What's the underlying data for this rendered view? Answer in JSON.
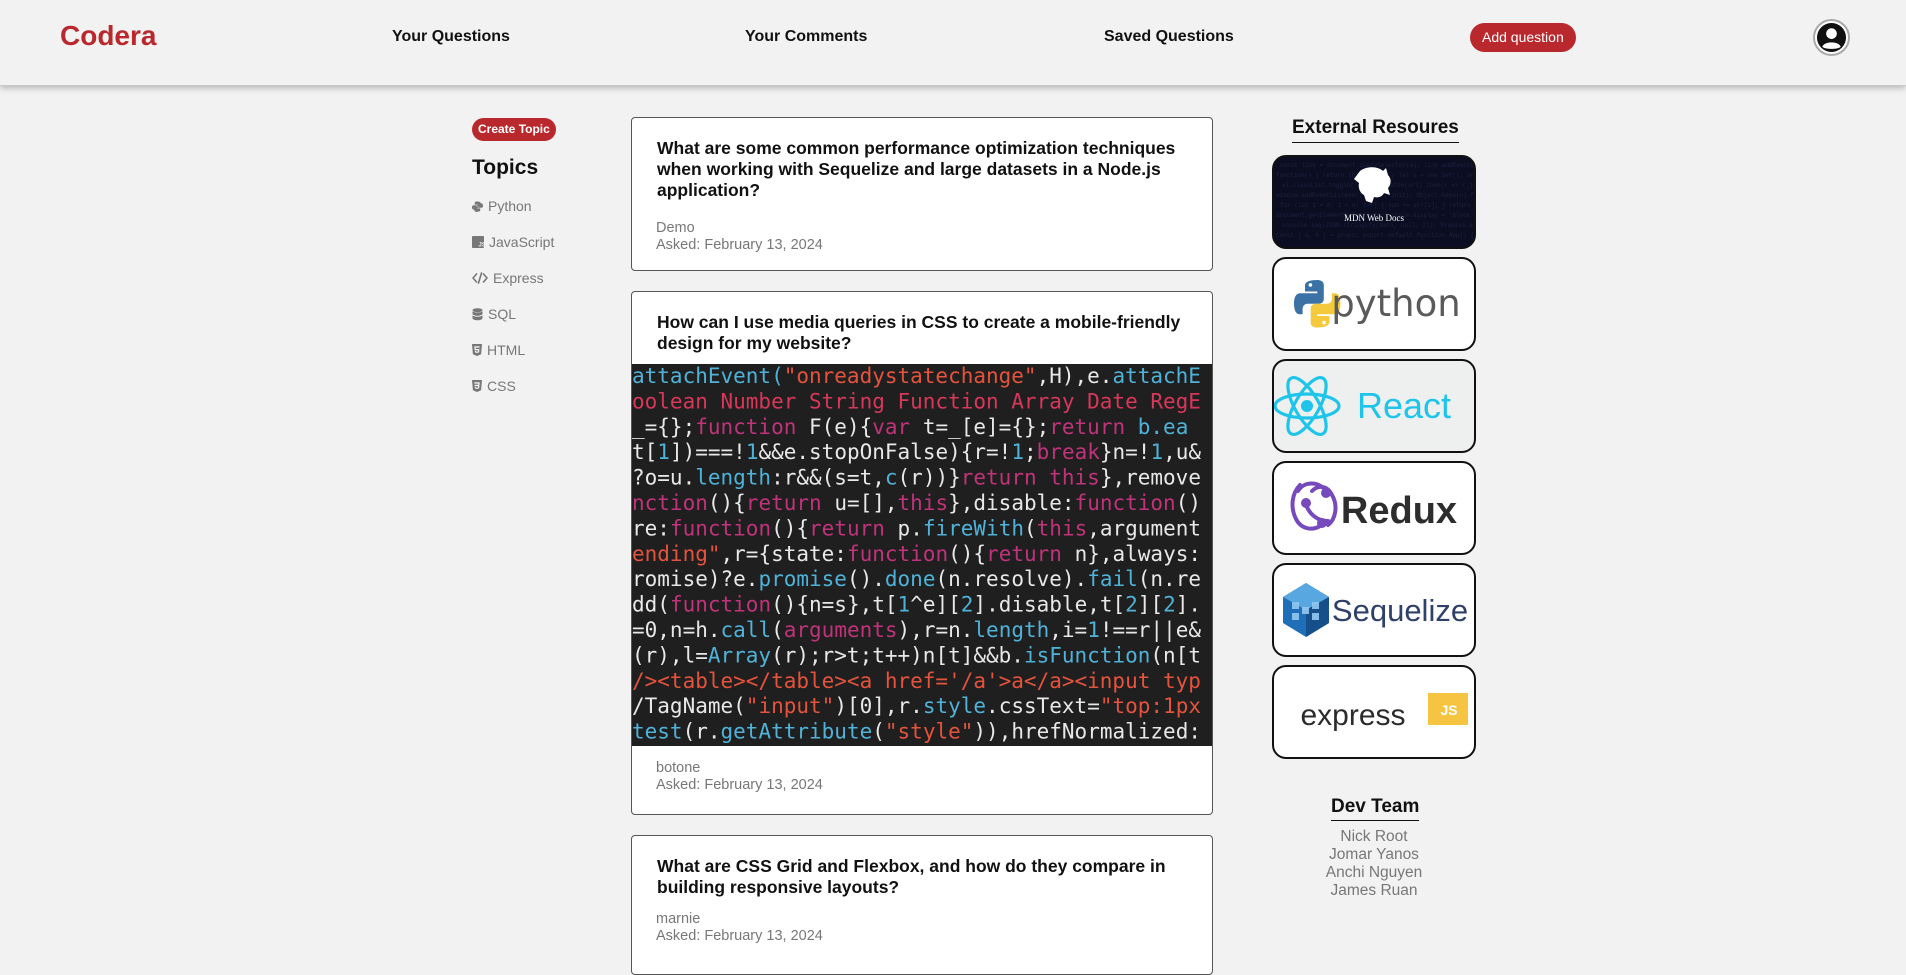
{
  "header": {
    "logo": "Codera",
    "nav": [
      "Your Questions",
      "Your Comments",
      "Saved Questions"
    ],
    "add_question": "Add question",
    "brand_color": "#b9282c"
  },
  "sidebar": {
    "create_topic": "Create Topic",
    "title": "Topics",
    "topics": [
      {
        "label": "Python",
        "icon": "python-icon"
      },
      {
        "label": "JavaScript",
        "icon": "javascript-icon"
      },
      {
        "label": "Express",
        "icon": "code-icon"
      },
      {
        "label": "SQL",
        "icon": "database-icon"
      },
      {
        "label": "HTML",
        "icon": "html5-icon"
      },
      {
        "label": "CSS",
        "icon": "css3-icon"
      }
    ]
  },
  "questions": [
    {
      "title": "What are some common performance optimization techniques when working with Sequelize and large datasets in a Node.js application?",
      "author": "Demo",
      "asked": "Asked: February 13, 2024"
    },
    {
      "title": "How can I use media queries in CSS to create a mobile-friendly design for my website?",
      "has_image": true,
      "author": "botone",
      "asked": "Asked: February 13, 2024"
    },
    {
      "title": "What are CSS Grid and Flexbox, and how do they compare in building responsive layouts?",
      "author": "marnie",
      "asked": "Asked: February 13, 2024"
    }
  ],
  "code_image_lines": [
    {
      "segments": [
        {
          "t": "attachEvent(",
          "c": "#4fb3d9"
        },
        {
          "t": "\"onreadystatechange\"",
          "c": "#e5533d"
        },
        {
          "t": ",H),e.",
          "c": "#e8e8e8"
        },
        {
          "t": "attachE",
          "c": "#4fb3d9"
        }
      ]
    },
    {
      "segments": [
        {
          "t": "oolean Number String Function Array Date RegE",
          "c": "#d8375a"
        }
      ]
    },
    {
      "segments": [
        {
          "t": " _={};",
          "c": "#e8e8e8"
        },
        {
          "t": "function ",
          "c": "#c0337a"
        },
        {
          "t": "F(e){",
          "c": "#e8e8e8"
        },
        {
          "t": "var ",
          "c": "#c0337a"
        },
        {
          "t": "t=_[e]={};",
          "c": "#e8e8e8"
        },
        {
          "t": "return ",
          "c": "#c0337a"
        },
        {
          "t": "b.ea",
          "c": "#4fb3d9"
        }
      ]
    },
    {
      "segments": [
        {
          "t": "t[",
          "c": "#e8e8e8"
        },
        {
          "t": "1",
          "c": "#4fb3d9"
        },
        {
          "t": "])===!",
          "c": "#e8e8e8"
        },
        {
          "t": "1",
          "c": "#4fb3d9"
        },
        {
          "t": "&&e.stopOnFalse){r=!",
          "c": "#e8e8e8"
        },
        {
          "t": "1",
          "c": "#4fb3d9"
        },
        {
          "t": ";",
          "c": "#e8e8e8"
        },
        {
          "t": "break",
          "c": "#c0337a"
        },
        {
          "t": "}n=!",
          "c": "#e8e8e8"
        },
        {
          "t": "1",
          "c": "#4fb3d9"
        },
        {
          "t": ",u&",
          "c": "#e8e8e8"
        }
      ]
    },
    {
      "segments": [
        {
          "t": "?o=u.",
          "c": "#e8e8e8"
        },
        {
          "t": "length",
          "c": "#4fb3d9"
        },
        {
          "t": ":r&&(s=t,",
          "c": "#e8e8e8"
        },
        {
          "t": "c",
          "c": "#4fb3d9"
        },
        {
          "t": "(r))}",
          "c": "#e8e8e8"
        },
        {
          "t": "return this",
          "c": "#c0337a"
        },
        {
          "t": "},remove",
          "c": "#e8e8e8"
        }
      ]
    },
    {
      "segments": [
        {
          "t": "nction",
          "c": "#c0337a"
        },
        {
          "t": "(){",
          "c": "#e8e8e8"
        },
        {
          "t": "return ",
          "c": "#c0337a"
        },
        {
          "t": "u=[],",
          "c": "#e8e8e8"
        },
        {
          "t": "this",
          "c": "#c0337a"
        },
        {
          "t": "},disable:",
          "c": "#e8e8e8"
        },
        {
          "t": "function",
          "c": "#c0337a"
        },
        {
          "t": "()",
          "c": "#e8e8e8"
        }
      ]
    },
    {
      "segments": [
        {
          "t": "re:",
          "c": "#e8e8e8"
        },
        {
          "t": "function",
          "c": "#c0337a"
        },
        {
          "t": "(){",
          "c": "#e8e8e8"
        },
        {
          "t": "return ",
          "c": "#c0337a"
        },
        {
          "t": "p.",
          "c": "#e8e8e8"
        },
        {
          "t": "fireWith",
          "c": "#4fb3d9"
        },
        {
          "t": "(",
          "c": "#e8e8e8"
        },
        {
          "t": "this",
          "c": "#c0337a"
        },
        {
          "t": ",argument",
          "c": "#e8e8e8"
        }
      ]
    },
    {
      "segments": [
        {
          "t": "ending\"",
          "c": "#e5533d"
        },
        {
          "t": ",r={state:",
          "c": "#e8e8e8"
        },
        {
          "t": "function",
          "c": "#c0337a"
        },
        {
          "t": "(){",
          "c": "#e8e8e8"
        },
        {
          "t": "return ",
          "c": "#c0337a"
        },
        {
          "t": "n},always:",
          "c": "#e8e8e8"
        }
      ]
    },
    {
      "segments": [
        {
          "t": "romise)?e.",
          "c": "#e8e8e8"
        },
        {
          "t": "promise",
          "c": "#4fb3d9"
        },
        {
          "t": "().",
          "c": "#e8e8e8"
        },
        {
          "t": "done",
          "c": "#4fb3d9"
        },
        {
          "t": "(n.resolve).",
          "c": "#e8e8e8"
        },
        {
          "t": "fail",
          "c": "#4fb3d9"
        },
        {
          "t": "(n.re",
          "c": "#e8e8e8"
        }
      ]
    },
    {
      "segments": [
        {
          "t": "dd(",
          "c": "#e8e8e8"
        },
        {
          "t": "function",
          "c": "#c0337a"
        },
        {
          "t": "(){n=s},t[",
          "c": "#e8e8e8"
        },
        {
          "t": "1",
          "c": "#4fb3d9"
        },
        {
          "t": "^e][",
          "c": "#e8e8e8"
        },
        {
          "t": "2",
          "c": "#4fb3d9"
        },
        {
          "t": "].disable,t[",
          "c": "#e8e8e8"
        },
        {
          "t": "2",
          "c": "#4fb3d9"
        },
        {
          "t": "][",
          "c": "#e8e8e8"
        },
        {
          "t": "2",
          "c": "#4fb3d9"
        },
        {
          "t": "].",
          "c": "#e8e8e8"
        }
      ]
    },
    {
      "segments": [
        {
          "t": "=0,n=h.",
          "c": "#e8e8e8"
        },
        {
          "t": "call",
          "c": "#4fb3d9"
        },
        {
          "t": "(",
          "c": "#e8e8e8"
        },
        {
          "t": "arguments",
          "c": "#c0337a"
        },
        {
          "t": "),r=n.",
          "c": "#e8e8e8"
        },
        {
          "t": "length",
          "c": "#4fb3d9"
        },
        {
          "t": ",i=",
          "c": "#e8e8e8"
        },
        {
          "t": "1",
          "c": "#4fb3d9"
        },
        {
          "t": "!==r||e&",
          "c": "#e8e8e8"
        }
      ]
    },
    {
      "segments": [
        {
          "t": "(r),l=",
          "c": "#e8e8e8"
        },
        {
          "t": "Array",
          "c": "#4fb3d9"
        },
        {
          "t": "(r);r>t;t++)n[t]&&b.",
          "c": "#e8e8e8"
        },
        {
          "t": "isFunction",
          "c": "#4fb3d9"
        },
        {
          "t": "(n[t",
          "c": "#e8e8e8"
        }
      ]
    },
    {
      "segments": [
        {
          "t": "/><table></table><a href='/a'>a</a><input typ",
          "c": "#e5533d"
        }
      ]
    },
    {
      "segments": [
        {
          "t": "/TagName(",
          "c": "#e8e8e8"
        },
        {
          "t": "\"input\"",
          "c": "#e5533d"
        },
        {
          "t": ")[0],r.",
          "c": "#e8e8e8"
        },
        {
          "t": "style",
          "c": "#4fb3d9"
        },
        {
          "t": ".cssText=",
          "c": "#e8e8e8"
        },
        {
          "t": "\"top:1px",
          "c": "#e5533d"
        }
      ]
    },
    {
      "segments": [
        {
          "t": "test",
          "c": "#4fb3d9"
        },
        {
          "t": "(r.",
          "c": "#e8e8e8"
        },
        {
          "t": "getAttribute",
          "c": "#4fb3d9"
        },
        {
          "t": "(",
          "c": "#e8e8e8"
        },
        {
          "t": "\"style\"",
          "c": "#e5533d"
        },
        {
          "t": ")),hrefNormalized:",
          "c": "#e8e8e8"
        }
      ]
    }
  ],
  "right_sidebar": {
    "external_title": "External Resoures",
    "resources": [
      {
        "name": "mdn",
        "label": "MDN Web Docs"
      },
      {
        "name": "python",
        "label": "python"
      },
      {
        "name": "react",
        "label": "React"
      },
      {
        "name": "redux",
        "label": "Redux"
      },
      {
        "name": "sequelize",
        "label": "Sequelize"
      },
      {
        "name": "express",
        "label": "express",
        "badge": "JS"
      }
    ],
    "dev_title": "Dev Team",
    "devs": [
      "Nick Root",
      "Jomar Yanos",
      "Anchi Nguyen",
      "James Ruan"
    ]
  }
}
